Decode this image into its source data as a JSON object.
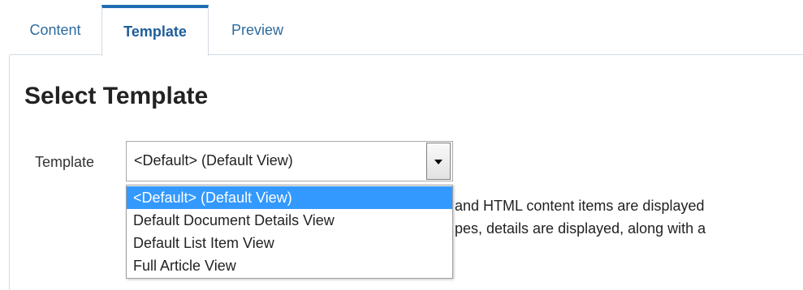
{
  "tabs": [
    {
      "label": "Content"
    },
    {
      "label": "Template"
    },
    {
      "label": "Preview"
    }
  ],
  "page": {
    "heading": "Select Template"
  },
  "template_field": {
    "label": "Template",
    "selected": "<Default> (Default View)",
    "options": [
      "<Default> (Default View)",
      "Default Document Details View",
      "Default List Item View",
      "Full Article View"
    ]
  },
  "description": {
    "line1": "and HTML content items are displayed",
    "line2": "pes, details are displayed, along with a"
  },
  "colors": {
    "accent": "#1f6db3",
    "highlight": "#3399ff",
    "tab_text": "#2e6b9e"
  }
}
